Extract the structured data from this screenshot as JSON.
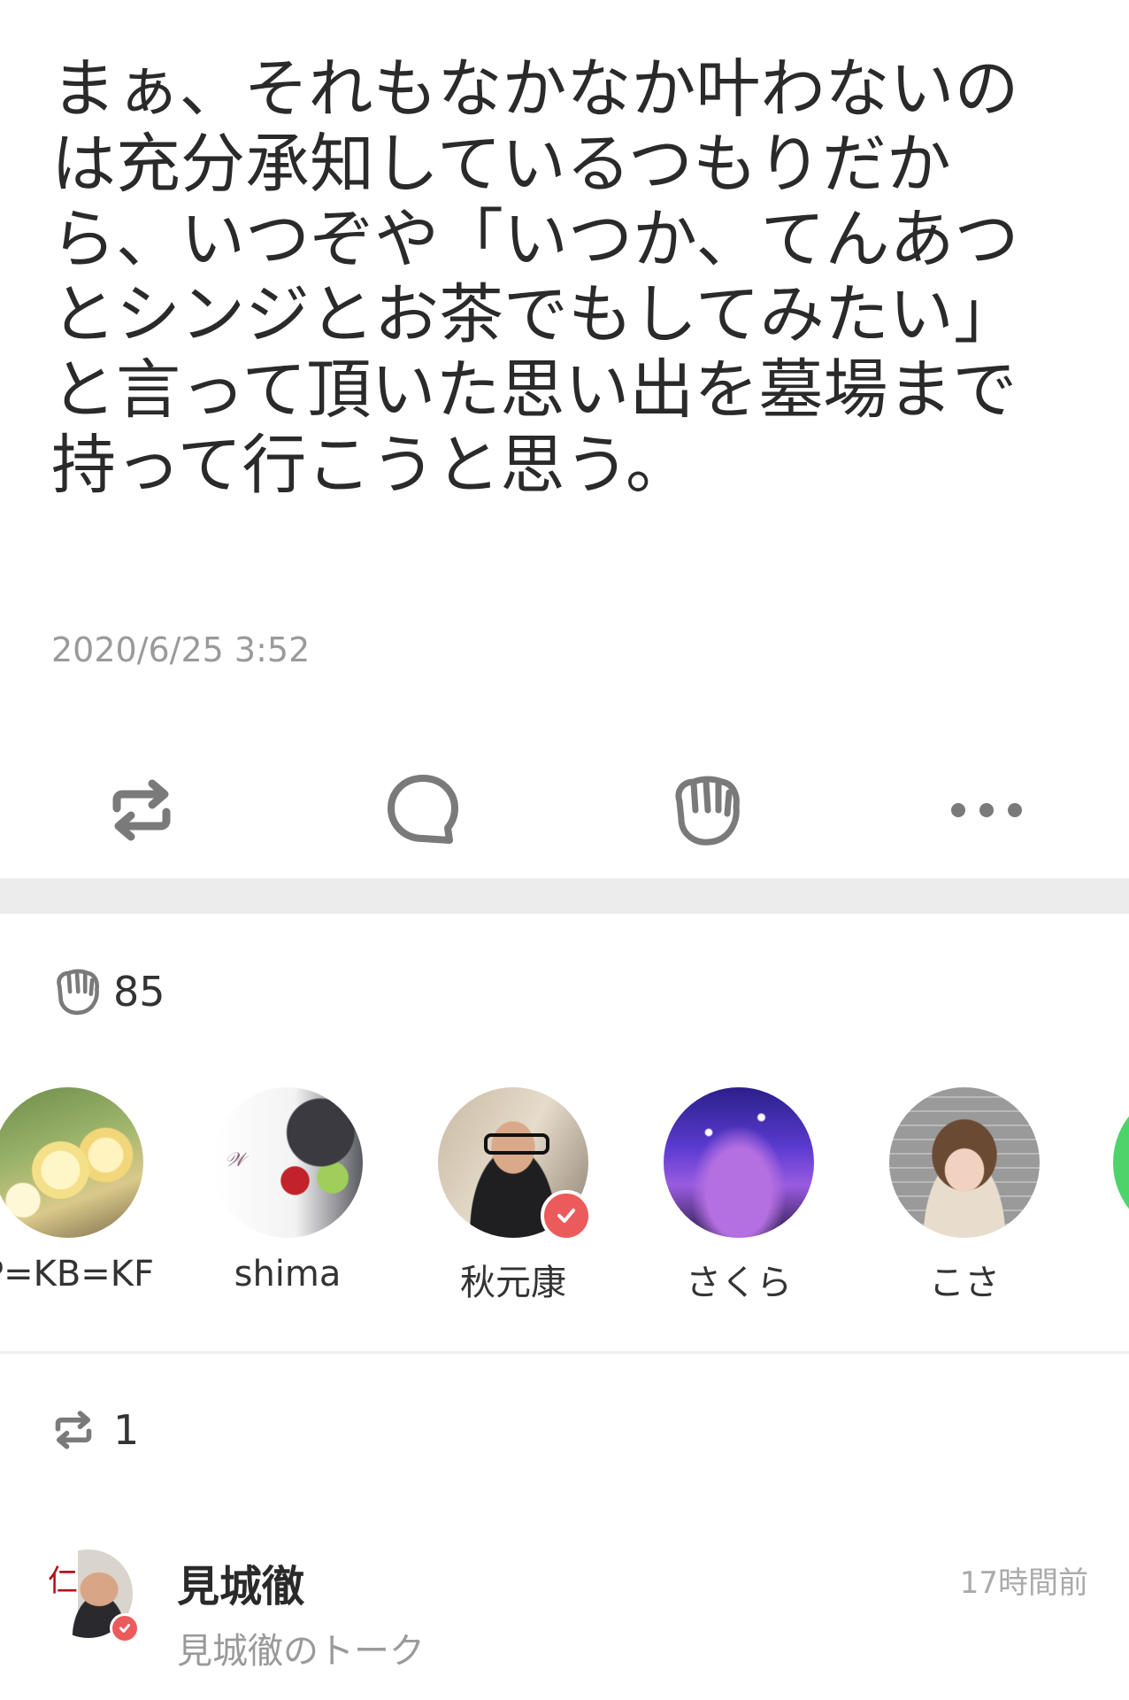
{
  "post": {
    "body": "まぁ、それもなかなか叶わないのは充分承知しているつもりだから、いつぞや「いつか、てんあつとシンジとお茶でもしてみたい」と言って頂いた思い出を墓場まで持って行こうと思う。",
    "timestamp": "2020/6/25 3:52"
  },
  "actions": {
    "icons": [
      "repost-icon",
      "comment-icon",
      "clap-icon",
      "more-icon"
    ],
    "color": "#7a7a7a"
  },
  "likes": {
    "icon": "clap-icon",
    "count": "85",
    "users": [
      {
        "name": "P=KB=KF",
        "verified": false
      },
      {
        "name": "shima",
        "verified": false
      },
      {
        "name": "秋元康",
        "verified": true
      },
      {
        "name": "さくら",
        "verified": false
      },
      {
        "name": "こさ",
        "verified": false
      }
    ]
  },
  "shares": {
    "icon": "repost-icon",
    "count": "1",
    "items": [
      {
        "user": "見城徹",
        "source": "見城徹のトーク",
        "time": "17時間前",
        "verified": true
      }
    ]
  },
  "colors": {
    "verified": "#ec5b5b",
    "muted": "#9a9a9a",
    "divider": "#ececec",
    "accent_green": "#4cd46a"
  }
}
